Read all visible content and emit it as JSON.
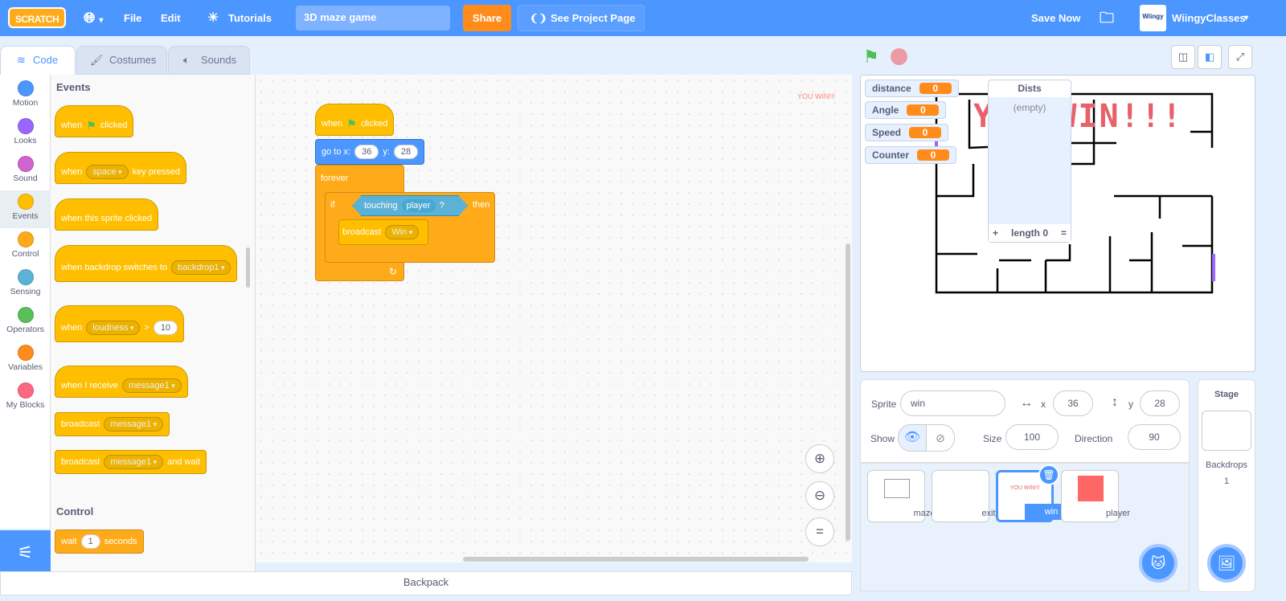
{
  "menubar": {
    "logo": "SCRATCH",
    "language_icon": "globe-icon",
    "file": "File",
    "edit": "Edit",
    "tutorials": "Tutorials",
    "project_title": "3D maze game",
    "share": "Share",
    "see_project_page": "See Project Page",
    "save_now": "Save Now",
    "username": "WiingyClasses",
    "avatar_text": "Wiingy"
  },
  "tabs": [
    {
      "label": "Code",
      "active": true
    },
    {
      "label": "Costumes"
    },
    {
      "label": "Sounds"
    }
  ],
  "categories": [
    {
      "label": "Motion",
      "color": "#4c97ff"
    },
    {
      "label": "Looks",
      "color": "#9966ff"
    },
    {
      "label": "Sound",
      "color": "#cf63cf"
    },
    {
      "label": "Events",
      "color": "#ffbf00",
      "selected": true
    },
    {
      "label": "Control",
      "color": "#ffab19"
    },
    {
      "label": "Sensing",
      "color": "#5cb1d6"
    },
    {
      "label": "Operators",
      "color": "#59c059"
    },
    {
      "label": "Variables",
      "color": "#ff8c1a"
    },
    {
      "label": "My Blocks",
      "color": "#ff6680"
    }
  ],
  "palette": {
    "events_title": "Events",
    "b1": {
      "a": "when",
      "b": "clicked"
    },
    "b2": {
      "a": "when",
      "dd": "space",
      "b": "key pressed"
    },
    "b3": {
      "a": "when this sprite clicked"
    },
    "b4": {
      "a": "when backdrop switches to",
      "dd": "backdrop1"
    },
    "b5": {
      "a": "when",
      "dd": "loudness",
      "op": ">",
      "n": "10"
    },
    "b6": {
      "a": "when I receive",
      "dd": "message1"
    },
    "b7": {
      "a": "broadcast",
      "dd": "message1"
    },
    "b8": {
      "a": "broadcast",
      "dd": "message1",
      "b": "and wait"
    },
    "control_title": "Control",
    "b9": {
      "a": "wait",
      "n": "1",
      "b": "seconds"
    }
  },
  "script": {
    "hat": {
      "a": "when",
      "b": "clicked"
    },
    "goto": {
      "a": "go to x:",
      "x": "36",
      "ylabel": "y:",
      "y": "28"
    },
    "forever": "forever",
    "if": {
      "a": "if",
      "touching": "touching",
      "dd": "player",
      "q": "?",
      "then": "then"
    },
    "broadcast": {
      "a": "broadcast",
      "dd": "Win"
    },
    "stage_label": "YOU WIN!!!"
  },
  "stage": {
    "monitors": [
      {
        "name": "distance",
        "value": "0"
      },
      {
        "name": "Angle",
        "value": "0"
      },
      {
        "name": "Speed",
        "value": "0"
      },
      {
        "name": "Counter",
        "value": "0"
      }
    ],
    "list": {
      "title": "Dists",
      "empty": "(empty)",
      "add": "+",
      "length": "length 0",
      "resize": "="
    },
    "win_text": "YOU WIN!!!"
  },
  "sprite_info": {
    "sprite_label": "Sprite",
    "name": "win",
    "x_label": "x",
    "x": "36",
    "y_label": "y",
    "y": "28",
    "show_label": "Show",
    "size_label": "Size",
    "size": "100",
    "direction_label": "Direction",
    "direction": "90"
  },
  "sprites": [
    {
      "name": "maze"
    },
    {
      "name": "exit"
    },
    {
      "name": "win",
      "selected": true,
      "thumb": "YOU WIN!!!"
    },
    {
      "name": "player",
      "color": "#ff6666"
    }
  ],
  "stage_panel": {
    "title": "Stage",
    "backdrops_label": "Backdrops",
    "backdrops": "1"
  },
  "backpack": "Backpack"
}
